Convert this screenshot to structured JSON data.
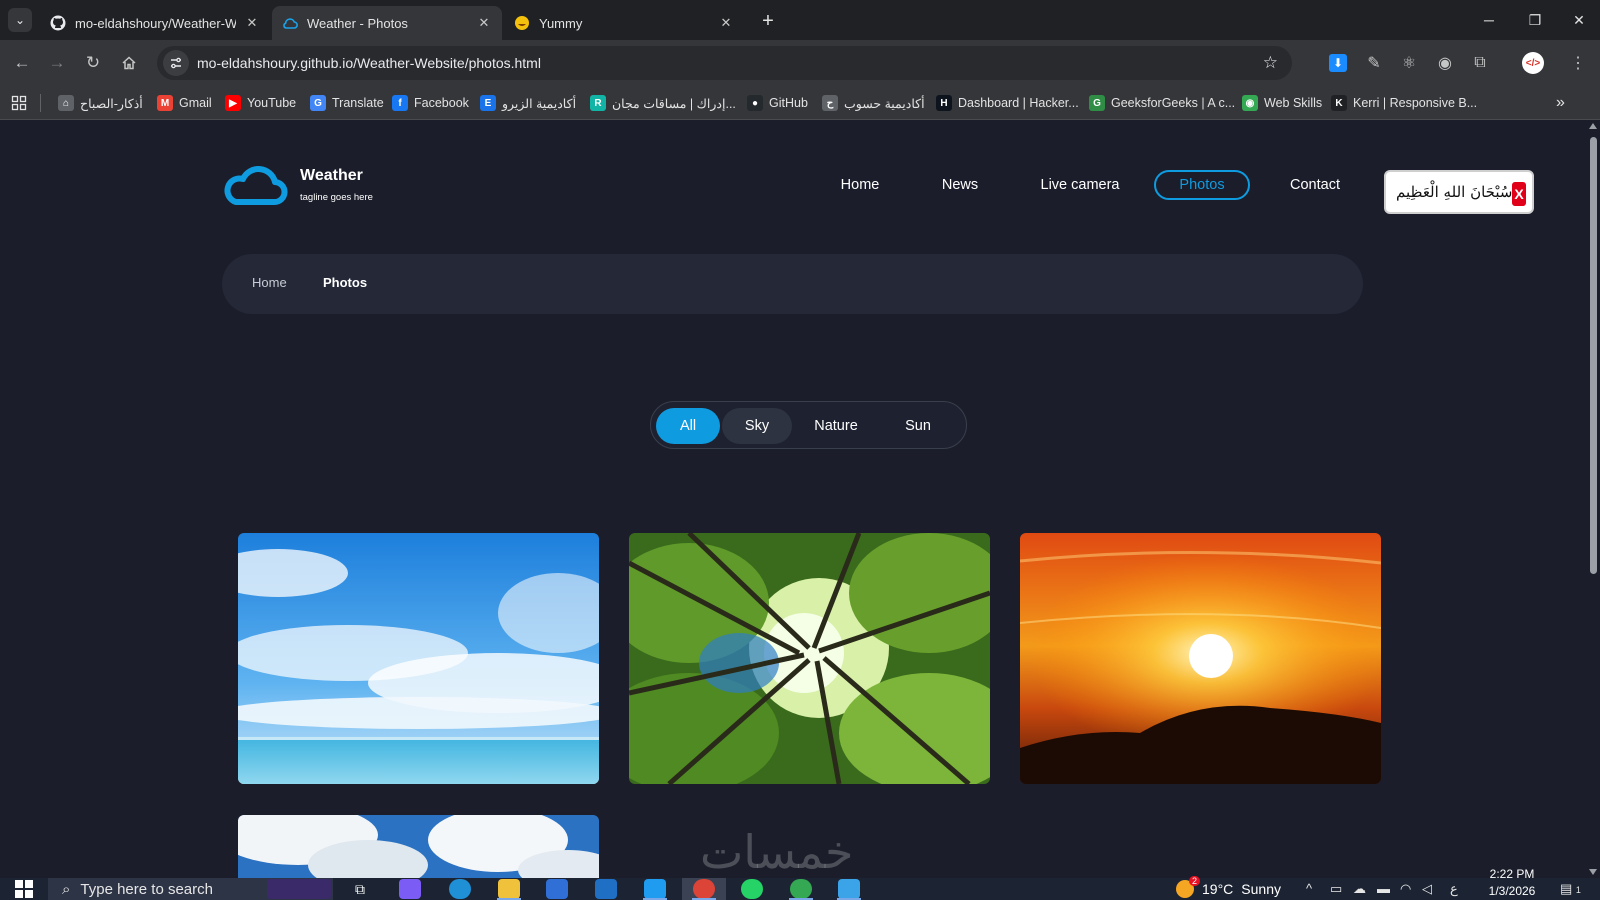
{
  "browser": {
    "tabs": [
      {
        "title": "mo-eldahshoury/Weather-Website",
        "favicon": "github-icon",
        "active": false
      },
      {
        "title": "Weather - Photos",
        "favicon": "cloud-icon",
        "active": true
      },
      {
        "title": "Yummy",
        "favicon": "emoji-icon",
        "active": false
      }
    ],
    "url": "mo-eldahshoury.github.io/Weather-Website/photos.html",
    "bookmarks": [
      {
        "label": "أذكار-الصباح",
        "icon": "bookmark-icon",
        "color": "#5f6368"
      },
      {
        "label": "Gmail",
        "icon": "gmail-icon",
        "color": "#ea4335"
      },
      {
        "label": "YouTube",
        "icon": "youtube-icon",
        "color": "#ff0000"
      },
      {
        "label": "Translate",
        "icon": "translate-icon",
        "color": "#4285f4"
      },
      {
        "label": "Facebook",
        "icon": "facebook-icon",
        "color": "#1877f2"
      },
      {
        "label": "أكاديمية الزيرو",
        "icon": "e-icon",
        "color": "#1a73e8"
      },
      {
        "label": "إدراك | مساقات مجان...",
        "icon": "edraak-icon",
        "color": "#12b5a5"
      },
      {
        "label": "GitHub",
        "icon": "github-icon",
        "color": "#24292e"
      },
      {
        "label": "أكاديمية حسوب",
        "icon": "hsoub-icon",
        "color": "#5f6368"
      },
      {
        "label": "Dashboard | Hacker...",
        "icon": "hackerrank-icon",
        "color": "#0e141e"
      },
      {
        "label": "GeeksforGeeks | A c...",
        "icon": "gfg-icon",
        "color": "#2f8d46"
      },
      {
        "label": "Web Skills",
        "icon": "brain-icon",
        "color": "#34a853"
      },
      {
        "label": "Kerri | Responsive B...",
        "icon": "k-icon",
        "color": "#202124"
      }
    ]
  },
  "site": {
    "brand": {
      "title": "Weather",
      "tagline": "tagline goes here",
      "accent": "#0f9be0"
    },
    "nav": [
      {
        "label": "Home",
        "active": false
      },
      {
        "label": "News",
        "active": false
      },
      {
        "label": "Live camera",
        "active": false
      },
      {
        "label": "Photos",
        "active": true
      },
      {
        "label": "Contact",
        "active": false
      }
    ],
    "tasbeeh": {
      "text": "سُبْحَانَ اللهِ الْعَظِيم",
      "close": "X"
    },
    "breadcrumb": {
      "home": "Home",
      "current": "Photos"
    },
    "filters": [
      {
        "label": "All",
        "active": true
      },
      {
        "label": "Sky",
        "active": false
      },
      {
        "label": "Nature",
        "active": false
      },
      {
        "label": "Sun",
        "active": false
      }
    ]
  },
  "taskbar": {
    "search_placeholder": "Type here to search",
    "weather": {
      "badge": "2",
      "temp": "19°C",
      "condition": "Sunny"
    },
    "clock": {
      "time": "2:22 PM",
      "date": "1/3/2026"
    },
    "lang": "ع",
    "notifications": "1"
  },
  "watermark": "خمسات"
}
